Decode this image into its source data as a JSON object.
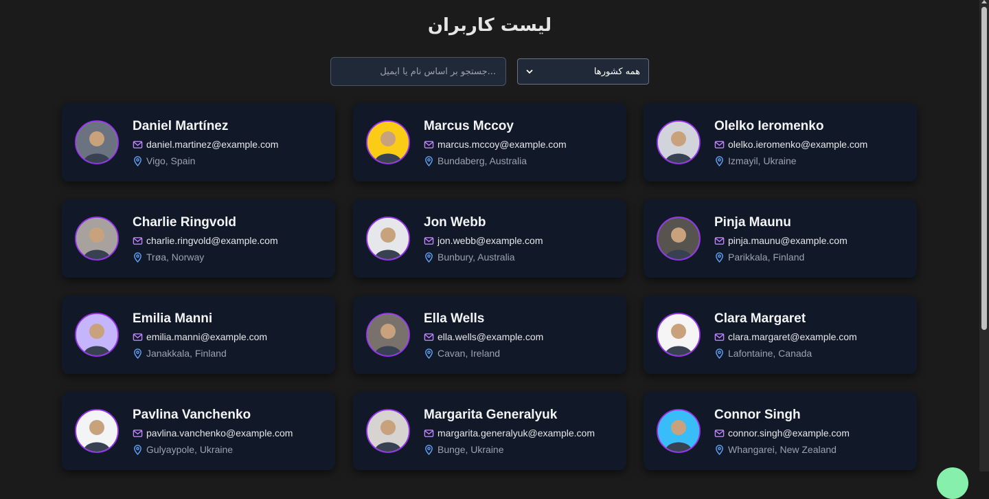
{
  "page": {
    "title": "لیست کاربران"
  },
  "search": {
    "placeholder": "...جستجو بر اساس نام یا ایمیل"
  },
  "filter": {
    "selected": "همه کشورها"
  },
  "colors": {
    "background": "#1b1b1b",
    "card": "#111827",
    "avatar_border": "#9333ea",
    "mail_icon": "#c084fc",
    "pin_icon": "#60a5fa"
  },
  "icons": {
    "email": "mail-icon",
    "location": "map-pin-icon"
  },
  "users": [
    {
      "name": "Daniel Martínez",
      "email": "daniel.martinez@example.com",
      "location": "Vigo, Spain",
      "avatar_bg": "#6b7280"
    },
    {
      "name": "Marcus Mccoy",
      "email": "marcus.mccoy@example.com",
      "location": "Bundaberg, Australia",
      "avatar_bg": "#facc15"
    },
    {
      "name": "Olelko Ieromenko",
      "email": "olelko.ieromenko@example.com",
      "location": "Izmayil, Ukraine",
      "avatar_bg": "#d1d5db"
    },
    {
      "name": "Charlie Ringvold",
      "email": "charlie.ringvold@example.com",
      "location": "Trøa, Norway",
      "avatar_bg": "#a8a29e"
    },
    {
      "name": "Jon Webb",
      "email": "jon.webb@example.com",
      "location": "Bunbury, Australia",
      "avatar_bg": "#e5e7eb"
    },
    {
      "name": "Pinja Maunu",
      "email": "pinja.maunu@example.com",
      "location": "Parikkala, Finland",
      "avatar_bg": "#57534e"
    },
    {
      "name": "Emilia Manni",
      "email": "emilia.manni@example.com",
      "location": "Janakkala, Finland",
      "avatar_bg": "#c4b5fd"
    },
    {
      "name": "Ella Wells",
      "email": "ella.wells@example.com",
      "location": "Cavan, Ireland",
      "avatar_bg": "#78716c"
    },
    {
      "name": "Clara Margaret",
      "email": "clara.margaret@example.com",
      "location": "Lafontaine, Canada",
      "avatar_bg": "#f5f5f5"
    },
    {
      "name": "Pavlina Vanchenko",
      "email": "pavlina.vanchenko@example.com",
      "location": "Gulyaypole, Ukraine",
      "avatar_bg": "#f3f4f6"
    },
    {
      "name": "Margarita Generalyuk",
      "email": "margarita.generalyuk@example.com",
      "location": "Bunge, Ukraine",
      "avatar_bg": "#d6d3d1"
    },
    {
      "name": "Connor Singh",
      "email": "connor.singh@example.com",
      "location": "Whangarei, New Zealand",
      "avatar_bg": "#38bdf8"
    }
  ]
}
